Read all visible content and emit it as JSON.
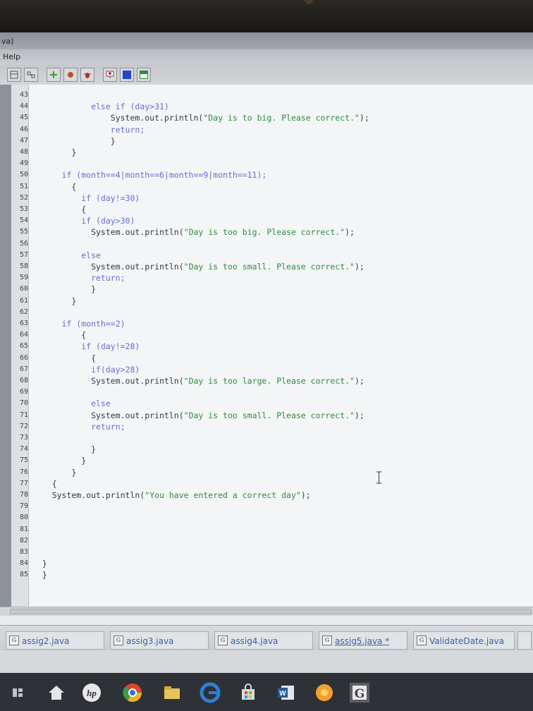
{
  "window": {
    "title_fragment": "va)"
  },
  "menu": {
    "help_label": "Help"
  },
  "toolbar": {
    "buttons": [
      {
        "icon": "class-diagram-icon"
      },
      {
        "icon": "uml-icon"
      },
      {
        "icon": "add-icon"
      },
      {
        "icon": "step-icon"
      },
      {
        "icon": "bug-icon"
      },
      {
        "icon": "presentation-icon"
      },
      {
        "icon": "blue-square-icon"
      },
      {
        "icon": "green-panel-icon"
      }
    ]
  },
  "editor": {
    "line_numbers": [
      "43",
      "44",
      "45",
      "46",
      "47",
      "48",
      "49",
      "50",
      "51",
      "52",
      "53",
      "54",
      "55",
      "56",
      "57",
      "58",
      "59",
      "60",
      "61",
      "62",
      "63",
      "64",
      "65",
      "66",
      "67",
      "68",
      "69",
      "70",
      "71",
      "72",
      "73",
      "74",
      "75",
      "76",
      "77",
      "78",
      "79",
      "80",
      "81",
      "82",
      "83",
      "84",
      "85"
    ],
    "lines": [
      "",
      "            else if (day>31)",
      "                System.out.println(\"Day is to big. Please correct.\");",
      "                return;",
      "                }",
      "        }",
      "",
      "      if (month==4|month==6|month==9|month==11);",
      "        {",
      "          if (day!=30)",
      "          {",
      "          if (day>30)",
      "            System.out.println(\"Day is too big. Please correct.\");",
      "",
      "          else",
      "            System.out.println(\"Day is too small. Please correct.\");",
      "            return;",
      "            }",
      "        }",
      "",
      "      if (month==2)",
      "          {",
      "          if (day!=28)",
      "            {",
      "            if(day>28)",
      "            System.out.println(\"Day is too large. Please correct.\");",
      "",
      "            else",
      "            System.out.println(\"Day is too small. Please correct.\");",
      "            return;",
      "",
      "            }",
      "          }",
      "        }",
      "    {",
      "    System.out.println(\"You have entered a correct day\");",
      "",
      "",
      "",
      "",
      "",
      "  }",
      "  }"
    ]
  },
  "tabs": [
    {
      "label": "assig2.java",
      "icon": "G",
      "active": false
    },
    {
      "label": "assig3.java",
      "icon": "G",
      "active": false
    },
    {
      "label": "assig4.java",
      "icon": "G",
      "active": false
    },
    {
      "label": "assig5.java *",
      "icon": "G",
      "active": true
    },
    {
      "label": "ValidateDate.java",
      "icon": "G",
      "active": false
    }
  ],
  "taskbar": {
    "items": [
      {
        "icon": "task-view-icon"
      },
      {
        "icon": "home-icon"
      },
      {
        "icon": "hp-icon",
        "label": "hp"
      },
      {
        "icon": "chrome-icon"
      },
      {
        "icon": "file-explorer-icon"
      },
      {
        "icon": "edge-icon"
      },
      {
        "icon": "store-icon"
      },
      {
        "icon": "word-icon",
        "label": "W"
      },
      {
        "icon": "orange-app-icon"
      },
      {
        "icon": "greenfoot-icon",
        "label": "G"
      }
    ]
  }
}
